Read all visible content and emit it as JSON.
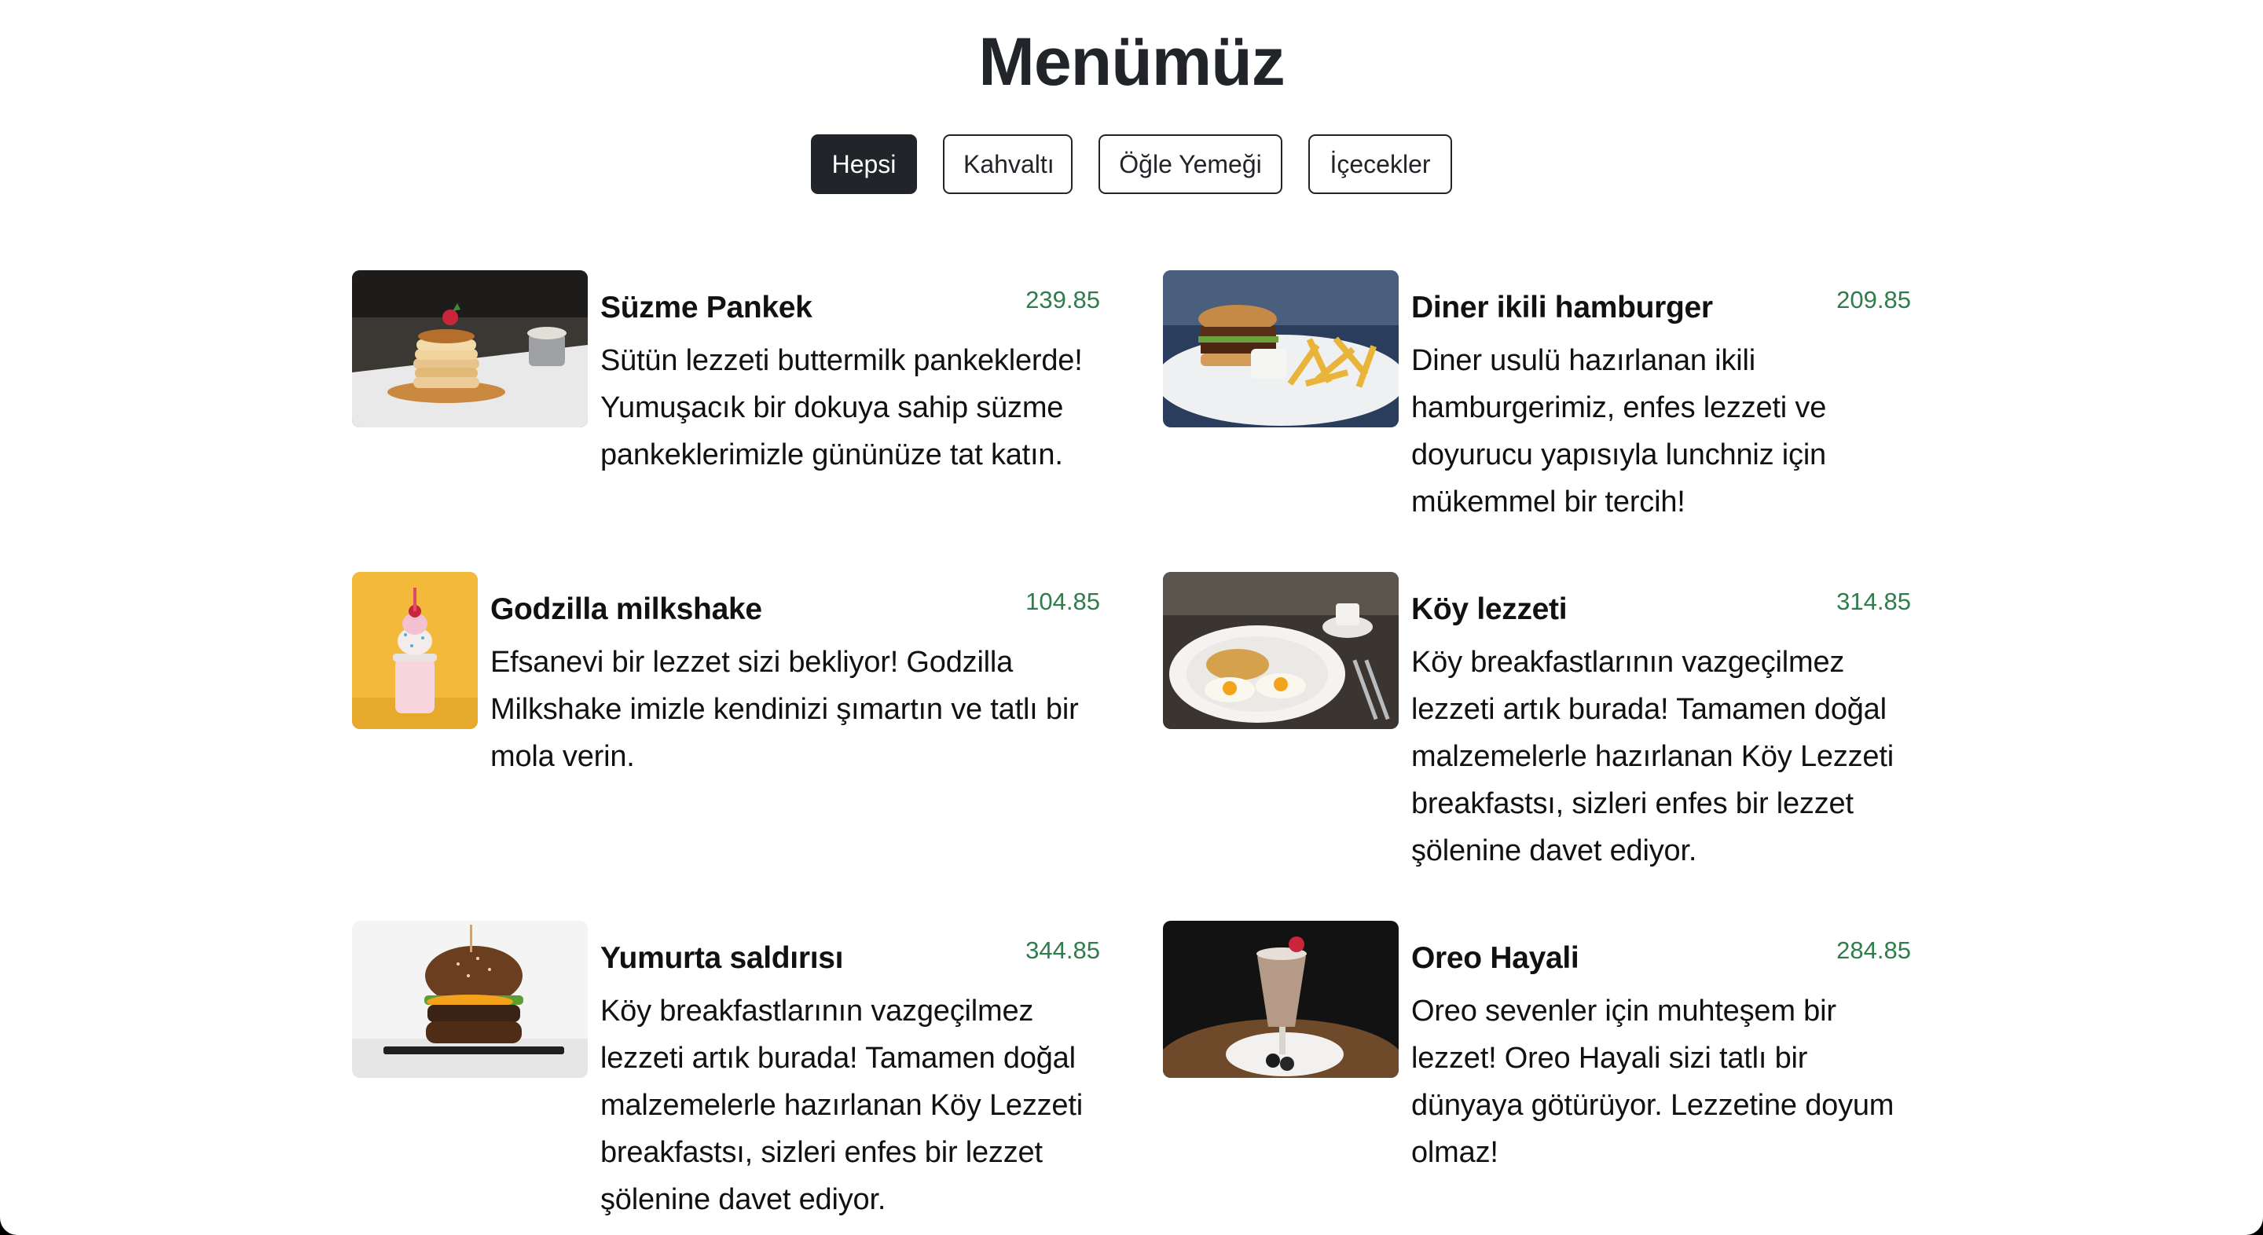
{
  "header": {
    "title": "Menümüz"
  },
  "filters": [
    {
      "label": "Hepsi",
      "active": true
    },
    {
      "label": "Kahvaltı",
      "active": false
    },
    {
      "label": "Öğle Yemeği",
      "active": false
    },
    {
      "label": "İçecekler",
      "active": false
    }
  ],
  "menu": [
    {
      "name": "Süzme Pankek",
      "price": "239.85",
      "image": "pancake-stack-photo",
      "description": "Sütün lezzeti buttermilk pankeklerde! Yumuşacık bir dokuya sahip süzme pankeklerimizle gününüze tat katın."
    },
    {
      "name": "Diner ikili hamburger",
      "price": "209.85",
      "image": "burger-and-fries-photo",
      "description": "Diner usulü hazırlanan ikili hamburgerimiz, enfes lezzeti ve doyurucu yapısıyla lunchniz için mükemmel bir tercih!"
    },
    {
      "name": "Godzilla milkshake",
      "price": "104.85",
      "image": "milkshake-jar-photo",
      "description": "Efsanevi bir lezzet sizi bekliyor! Godzilla Milkshake imizle kendinizi şımartın ve tatlı bir mola verin."
    },
    {
      "name": "Köy lezzeti",
      "price": "314.85",
      "image": "eggs-breakfast-plate-photo",
      "description": "Köy breakfastlarının vazgeçilmez lezzeti artık burada! Tamamen doğal malzemelerle hazırlanan Köy Lezzeti breakfastsı, sizleri enfes bir lezzet şölenine davet ediyor."
    },
    {
      "name": "Yumurta saldırısı",
      "price": "344.85",
      "image": "egg-burger-photo",
      "description": "Köy breakfastlarının vazgeçilmez lezzeti artık burada! Tamamen doğal malzemelerle hazırlanan Köy Lezzeti breakfastsı, sizleri enfes bir lezzet şölenine davet ediyor."
    },
    {
      "name": "Oreo Hayali",
      "price": "284.85",
      "image": "oreo-milkshake-photo",
      "description": "Oreo sevenler için muhteşem bir lezzet! Oreo Hayali sizi tatlı bir dünyaya götürüyor. Lezzetine doyum olmaz!"
    }
  ]
}
